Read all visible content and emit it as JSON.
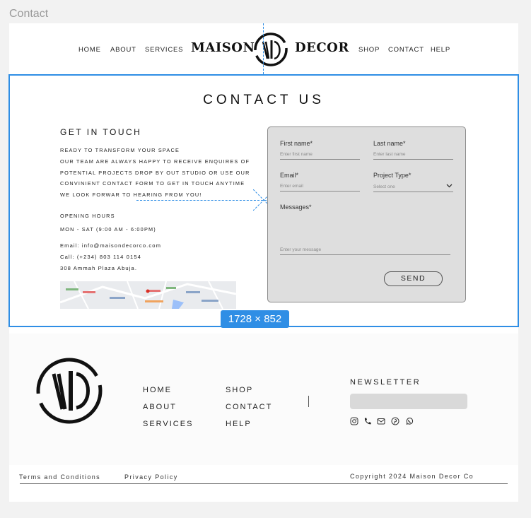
{
  "frame": {
    "label": "Contact"
  },
  "header": {
    "nav_left": [
      "HOME",
      "ABOUT",
      "SERVICES"
    ],
    "logo_left": "MAISON",
    "logo_right": "DECOR",
    "nav_right": [
      "SHOP",
      "CONTACT",
      "HELP"
    ]
  },
  "section": {
    "title": "CONTACT US",
    "get_in_touch": "GET IN TOUCH",
    "intro_lines": [
      "READY TO TRANSFORM YOUR SPACE",
      "OUR TEAM ARE ALWAYS HAPPY TO RECEIVE ENQUIRES OF",
      "POTENTIAL PROJECTS DROP BY OUT STUDIO OR USE OUR",
      "CONVINIENT CONTACT FORM TO GET IN TOUCH ANYTIME",
      "WE LOOK FORWAR TO HEARING FROM YOU!"
    ],
    "opening_hours_label": "OPENING HOURS",
    "opening_hours": "MON - SAT  (9:00 AM - 6:00PM)",
    "email": "Email: info@maisondecorco.com",
    "call": "Call: (+234) 803 114 0154",
    "address": "308 Ammah Plaza Abuja."
  },
  "form": {
    "first_name_label": "First name*",
    "first_name_placeholder": "Enter first name",
    "last_name_label": "Last name*",
    "last_name_placeholder": "Enter last name",
    "email_label": "Email*",
    "email_placeholder": "Enter email",
    "project_type_label": "Project Type*",
    "project_type_selected": "Select one",
    "messages_label": "Messages*",
    "message_placeholder": "Enter your message",
    "send_label": "SEND"
  },
  "size_badge": "1728 × 852",
  "footer": {
    "links_col1": [
      "HOME",
      "ABOUT",
      "SERVICES"
    ],
    "links_col2": [
      "SHOP",
      "CONTACT",
      "HELP"
    ],
    "newsletter_label": "NEWSLETTER",
    "social_icons": [
      "instagram-icon",
      "phone-icon",
      "mail-icon",
      "pinterest-icon",
      "whatsapp-icon"
    ],
    "terms": "Terms and Conditions",
    "privacy": "Privacy Policy",
    "copyright": "Copyright 2024 Maison Decor Co"
  },
  "colors": {
    "accent": "#2f8ee5",
    "form_bg": "#dedede",
    "input_bg": "#d9d9d9"
  }
}
